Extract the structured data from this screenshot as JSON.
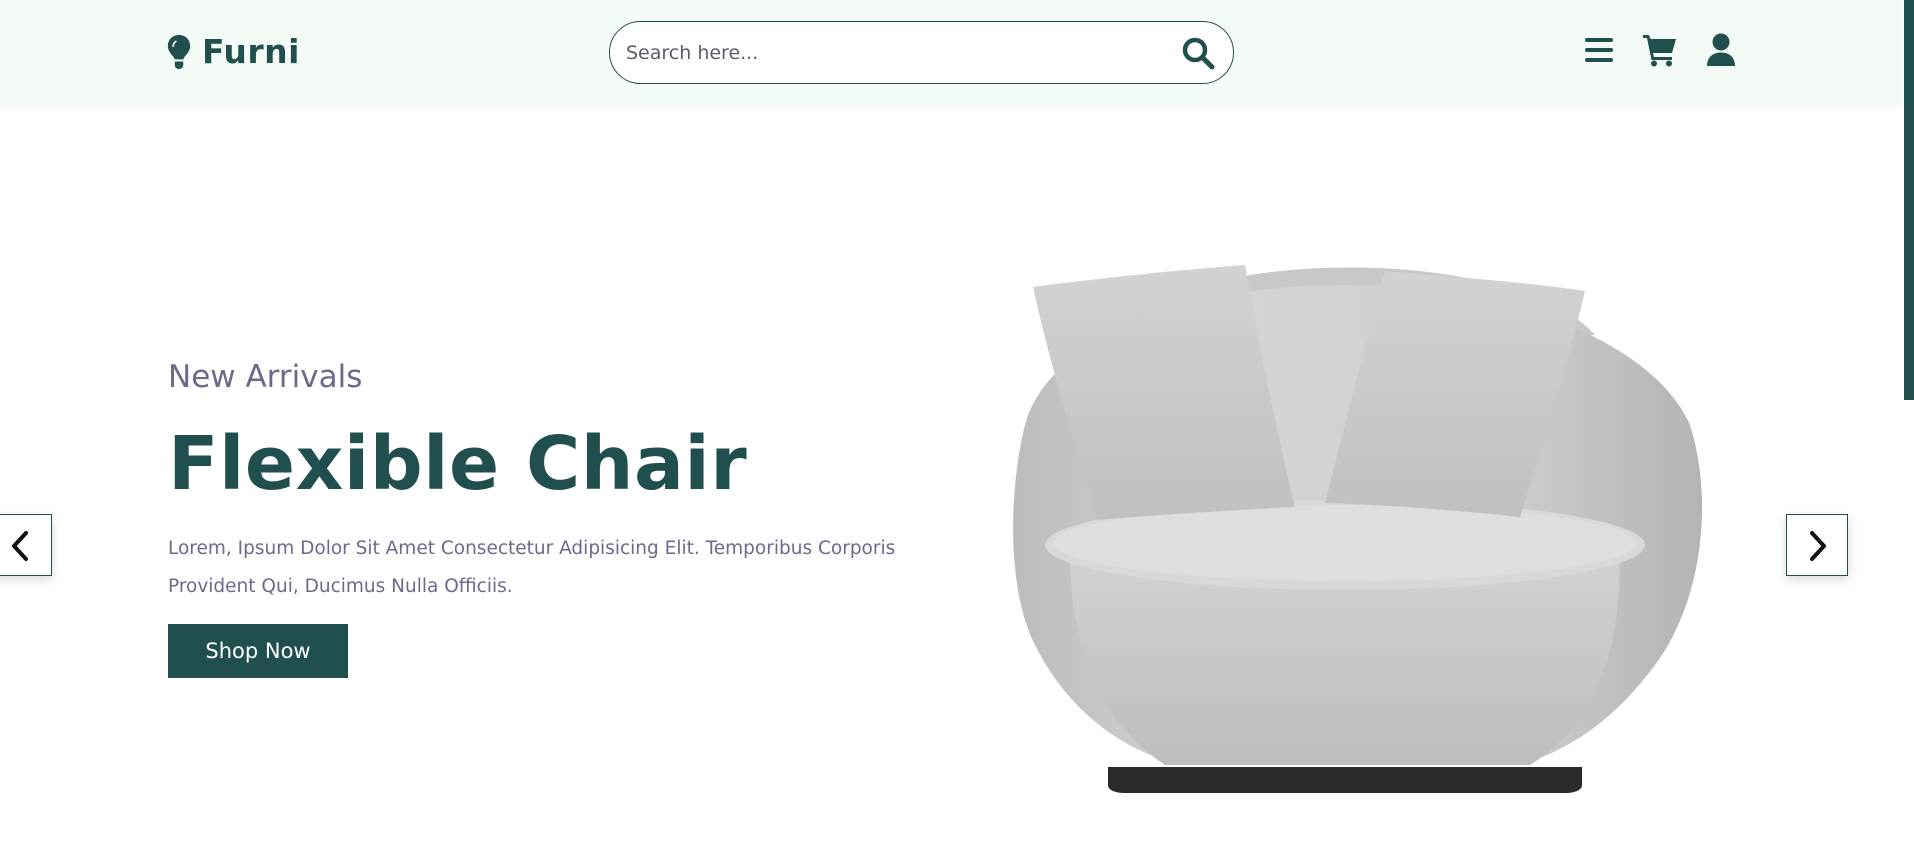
{
  "header": {
    "logo_text": "Furni",
    "logo_icon": "lightbulb-icon",
    "search": {
      "placeholder": "Search here...",
      "value": "",
      "icon": "search-icon"
    },
    "nav_icons": [
      "menu-icon",
      "cart-icon",
      "user-icon"
    ]
  },
  "hero": {
    "subtitle": "New Arrivals",
    "title": "Flexible Chair",
    "description": "Lorem, Ipsum Dolor Sit Amet Consectetur Adipisicing Elit. Temporibus Corporis Provident Qui, Ducimus Nulla Officiis.",
    "button_label": "Shop Now"
  },
  "slider": {
    "prev_icon": "chevron-left-icon",
    "next_icon": "chevron-right-icon"
  },
  "colors": {
    "brand": "#214f4e",
    "header_bg": "#f4faf5",
    "muted_text": "#6c6a8c"
  }
}
